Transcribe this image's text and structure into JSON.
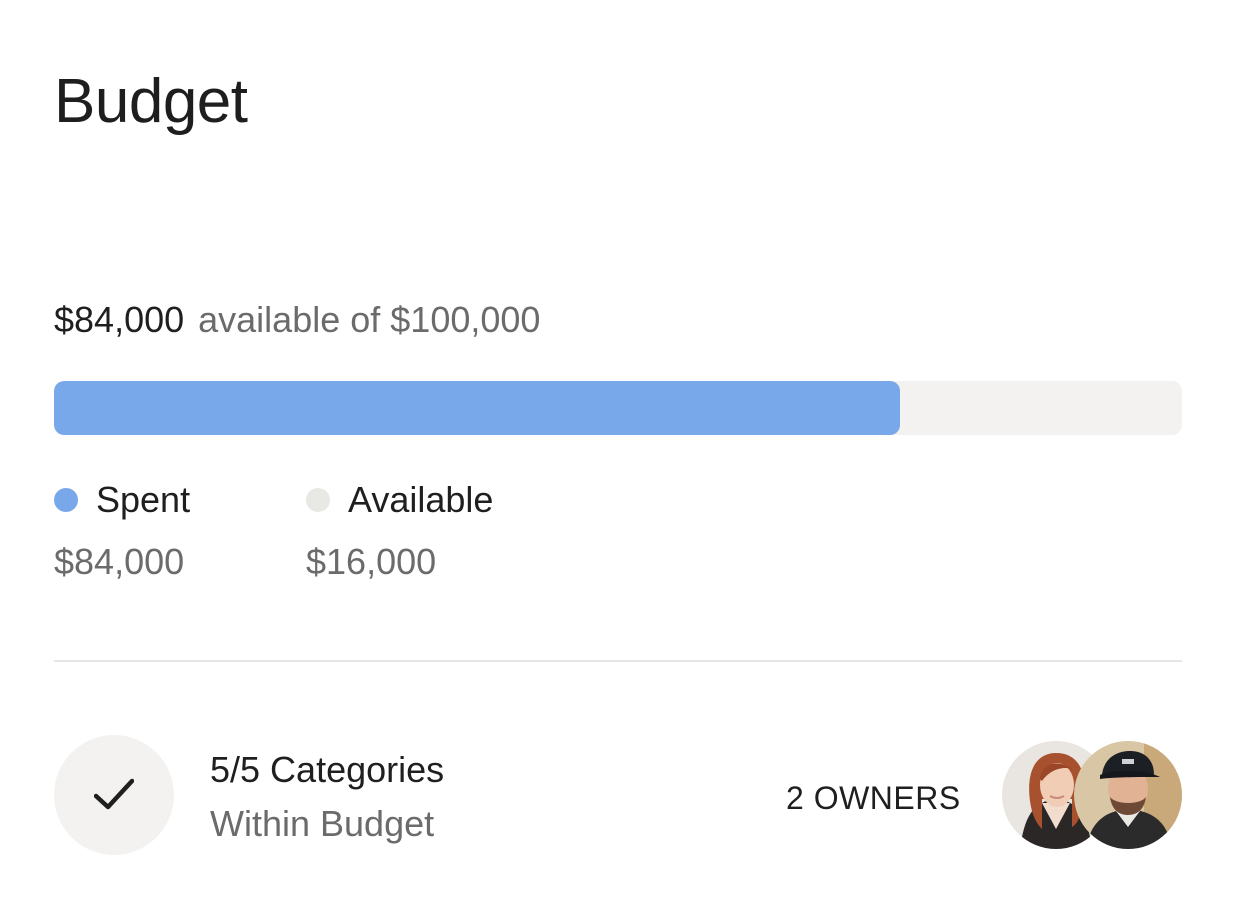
{
  "card": {
    "title": "Budget",
    "summary": {
      "amount": "$84,000",
      "text": "available of $100,000"
    },
    "progress": {
      "spent_fraction": 0.75,
      "fill_color": "#78a7ea",
      "track_color": "#f3f2f0"
    },
    "legend": [
      {
        "label": "Spent",
        "value": "$84,000",
        "color": "#78a7ea"
      },
      {
        "label": "Available",
        "value": "$16,000",
        "color": "#e8e8e5"
      }
    ],
    "categories": {
      "status_icon": "checkmark-icon",
      "line1": "5/5 Categories",
      "line2": "Within Budget"
    },
    "owners": {
      "label": "2 OWNERS",
      "avatars": [
        "owner-avatar-woman",
        "owner-avatar-man"
      ]
    }
  }
}
